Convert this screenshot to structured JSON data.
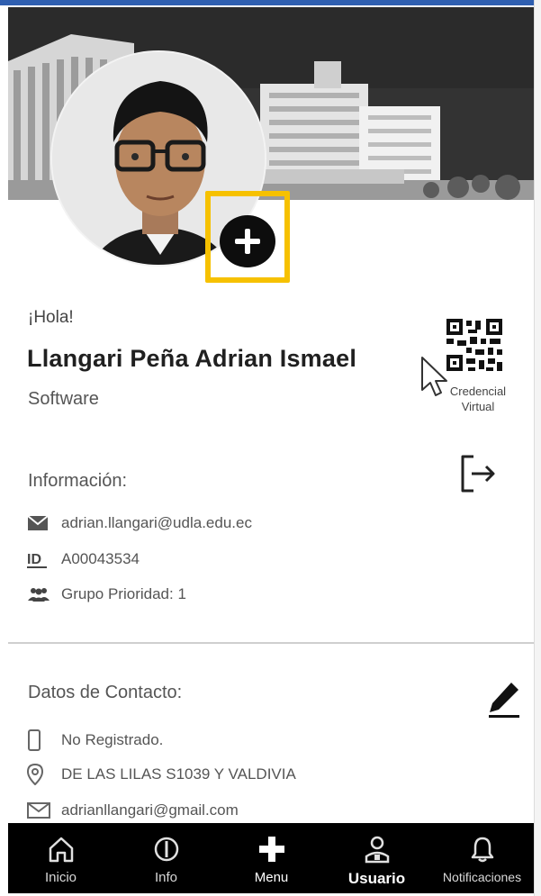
{
  "profile": {
    "greeting": "¡Hola!",
    "name": "Llangari Peña Adrian Ismael",
    "program": "Software",
    "add_photo_icon": "plus-circle-icon",
    "credential_label": "Credencial Virtual"
  },
  "info": {
    "title": "Información:",
    "email": "adrian.llangari@udla.edu.ec",
    "id": "A00043534",
    "group": "Grupo Prioridad:  1"
  },
  "contact": {
    "title": "Datos de Contacto:",
    "phone": "No Registrado.",
    "address": "DE LAS LILAS S1039 Y VALDIVIA",
    "personal_email": "adrianllangari@gmail.com"
  },
  "nav": {
    "items": [
      {
        "label": "Inicio",
        "icon": "home-icon"
      },
      {
        "label": "Info",
        "icon": "info-icon"
      },
      {
        "label": "Menu",
        "icon": "plus-icon"
      },
      {
        "label": "Usuario",
        "icon": "user-icon"
      },
      {
        "label": "Notificaciones",
        "icon": "bell-icon"
      }
    ],
    "active": "Usuario"
  },
  "colors": {
    "highlight": "#f6c100",
    "nav_bg": "#000000",
    "top_accent": "#2f5fb0"
  }
}
